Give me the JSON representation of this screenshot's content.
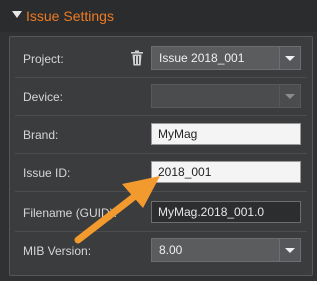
{
  "header": {
    "title": "Issue Settings"
  },
  "fields": {
    "project": {
      "label": "Project:",
      "value": "Issue 2018_001"
    },
    "device": {
      "label": "Device:",
      "value": ""
    },
    "brand": {
      "label": "Brand:",
      "value": "MyMag"
    },
    "issue_id": {
      "label": "Issue ID:",
      "value": "2018_001"
    },
    "filename": {
      "label": "Filename (GUID):",
      "value": "MyMag.2018_001.0"
    },
    "mib_version": {
      "label": "MIB Version:",
      "value": "8.00"
    }
  },
  "colors": {
    "accent": "#f07a22",
    "annotation_arrow": "#f29a2e",
    "panel_bg": "#2f3133"
  },
  "icons": {
    "collapse": "caret-down-icon",
    "delete": "trash-icon",
    "dropdown": "chevron-down-icon"
  }
}
